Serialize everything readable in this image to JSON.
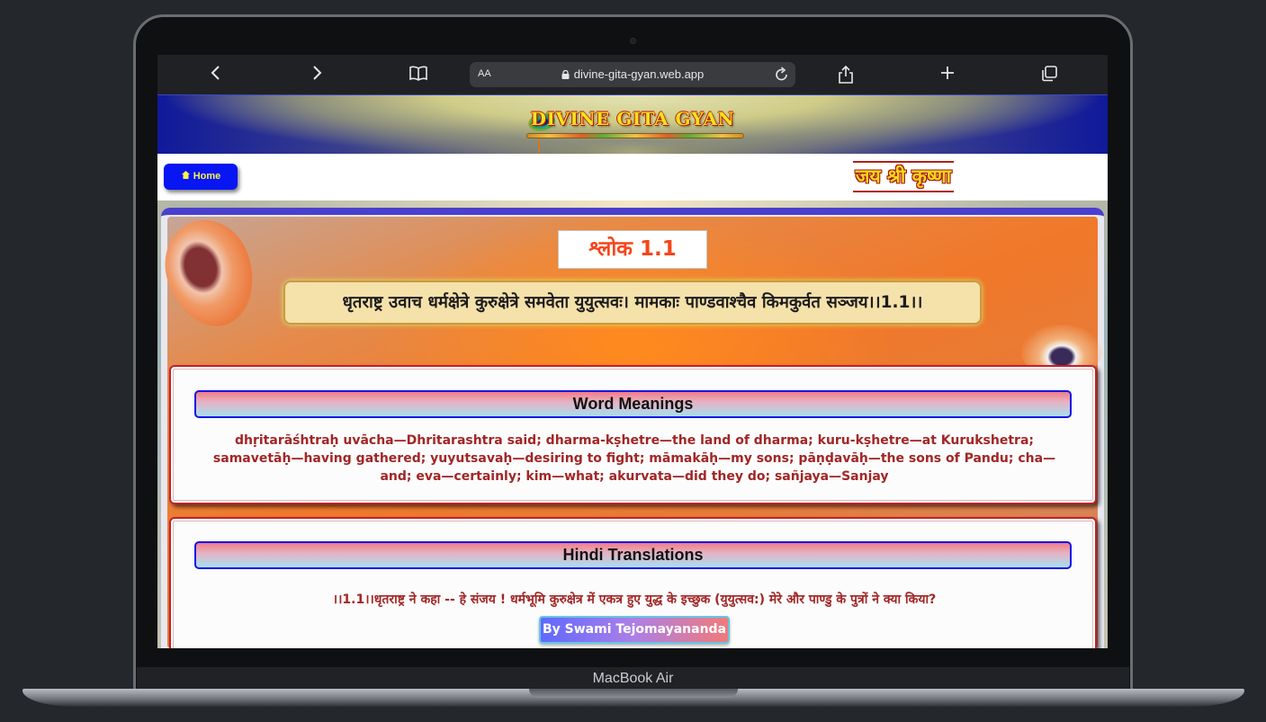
{
  "device": {
    "label": "MacBook Air"
  },
  "browser": {
    "url": "divine-gita-gyan.web.app",
    "text_size_label": "AA"
  },
  "site": {
    "title": "DIVINE GITA GYAN",
    "home_label": "Home",
    "greeting": "जय श्री कृष्णा"
  },
  "shloka": {
    "heading": "श्लोक 1.1",
    "verse": "धृतराष्ट्र उवाच धर्मक्षेत्रे कुरुक्षेत्रे समवेता युयुत्सवः। मामकाः पाण्डवाश्चैव किमकुर्वत सञ्जय।।1.1।।"
  },
  "word_meanings": {
    "heading": "Word Meanings",
    "text": "dhṛitarāśhtraḥ uvācha—Dhritarashtra said; dharma-kṣhetre—the land of dharma; kuru-kṣhetre—at Kurukshetra; samavetāḥ—having gathered; yuyutsavaḥ—desiring to fight; māmakāḥ—my sons; pāṇḍavāḥ—the sons of Pandu; cha—and; eva—certainly; kim—what; akurvata—did they do; sañjaya—Sanjay"
  },
  "hindi_translation": {
    "heading": "Hindi Translations",
    "text": "।।1.1।।धृतराष्ट्र ने कहा -- हे संजय ! धर्मभूमि कुरुक्षेत्र में एकत्र हुए युद्ध के इच्छुक (युयुत्सव:) मेरे और पाण्डु के पुत्रों ने क्या किया?",
    "author_label": "By Swami Tejomayananda"
  },
  "colors": {
    "home_button": "#0716f2",
    "card_heading_border": "#1414e8",
    "card_text": "#a22626",
    "shloka_heading": "#f5451b"
  }
}
